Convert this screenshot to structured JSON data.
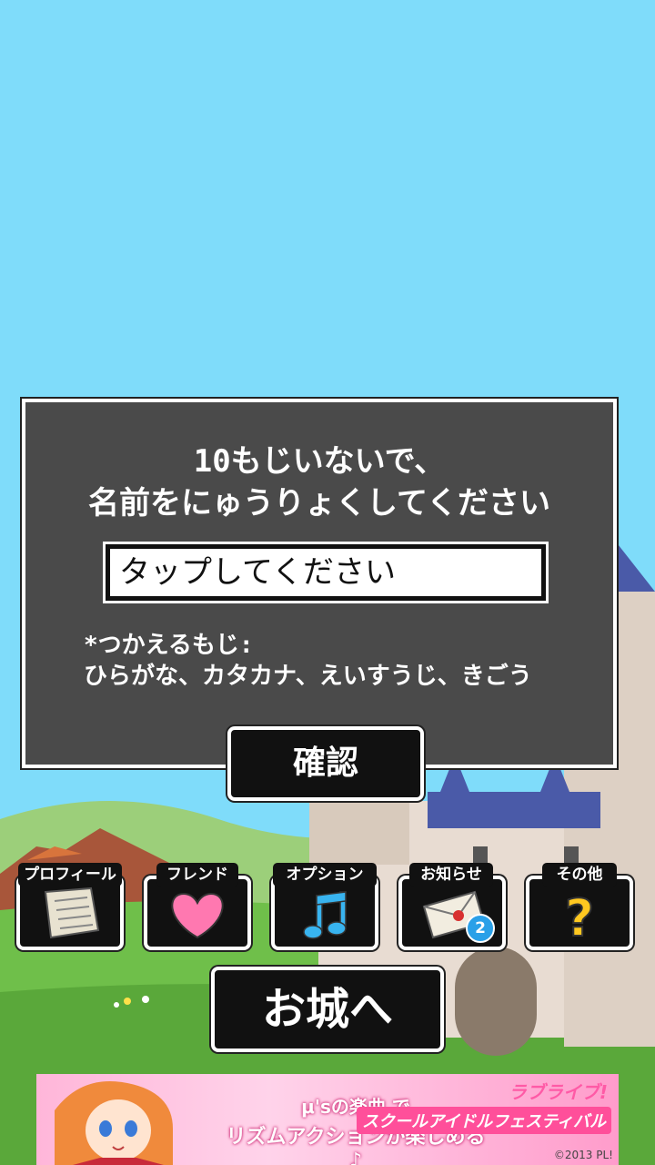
{
  "dialog": {
    "prompt_line1": "10もじいないで、",
    "prompt_line2": "名前をにゅうりょくしてください",
    "input_placeholder": "タップしてください",
    "allowed_line1": "*つかえるもじ:",
    "allowed_line2": "ひらがな、カタカナ、えいすうじ、きごう"
  },
  "confirm_label": "確認",
  "menu": {
    "profile": "プロフィール",
    "friend": "フレンド",
    "option": "オプション",
    "notice": "お知らせ",
    "notice_badge": "2",
    "other": "その他"
  },
  "castle_label": "お城へ",
  "banner": {
    "line1": "μ'sの楽曲 で",
    "line2": "リズムアクションが楽しめる♪",
    "logo1": "ラブライブ!",
    "logo2": "スクールアイドルフェスティバル",
    "copyright": "©2013 PL!"
  },
  "colors": {
    "sky": "#7fdcfa",
    "dialog_bg": "#4a4a4a",
    "button_bg": "#111111",
    "badge": "#2aa0e8",
    "banner_pink": "#ffb6d9"
  }
}
